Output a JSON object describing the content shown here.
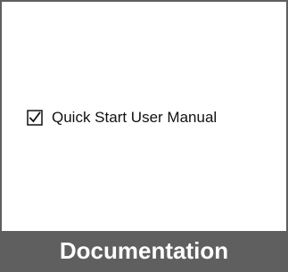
{
  "card": {
    "items": [
      {
        "checked": true,
        "label": "Quick Start User Manual"
      }
    ],
    "footer_label": "Documentation"
  },
  "colors": {
    "border": "#5f5f5f",
    "footer_background": "#5f5f5f",
    "footer_text": "#ffffff",
    "body_background": "#ffffff",
    "text": "#111111"
  },
  "icons": {
    "checkbox": "checked-checkbox-icon"
  }
}
